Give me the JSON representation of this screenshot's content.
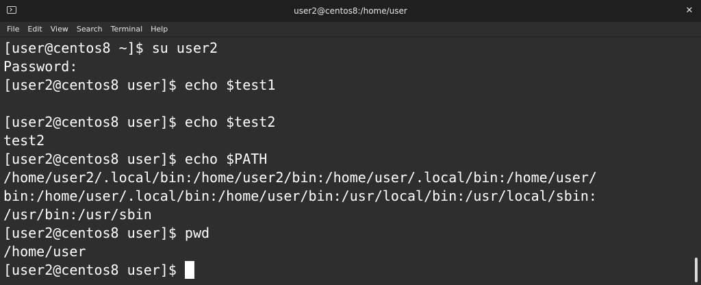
{
  "window": {
    "title": "user2@centos8:/home/user",
    "close_glyph": "✕"
  },
  "menu": [
    "File",
    "Edit",
    "View",
    "Search",
    "Terminal",
    "Help"
  ],
  "terminal": {
    "lines": [
      "[user@centos8 ~]$ su user2",
      "Password:",
      "[user2@centos8 user]$ echo $test1",
      "",
      "[user2@centos8 user]$ echo $test2",
      "test2",
      "[user2@centos8 user]$ echo $PATH",
      "/home/user2/.local/bin:/home/user2/bin:/home/user/.local/bin:/home/user/",
      "bin:/home/user/.local/bin:/home/user/bin:/usr/local/bin:/usr/local/sbin:",
      "/usr/bin:/usr/sbin",
      "[user2@centos8 user]$ pwd",
      "/home/user",
      "[user2@centos8 user]$ "
    ]
  },
  "colors": {
    "terminal_bg": "#2e2e2e",
    "terminal_fg": "#ffffff",
    "titlebar_bg": "#1f1f1f"
  }
}
